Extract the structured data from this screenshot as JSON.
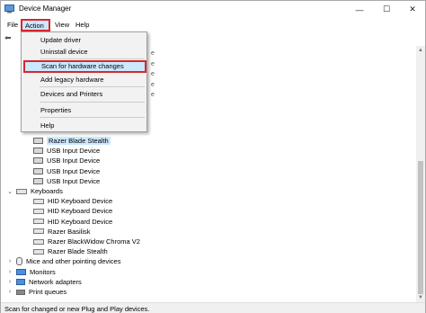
{
  "window": {
    "title": "Device Manager",
    "controls": {
      "minimize": "—",
      "maximize": "☐",
      "close": "✕"
    }
  },
  "menubar": {
    "file": "File",
    "action": "Action",
    "view": "View",
    "help": "Help"
  },
  "action_menu": {
    "items": [
      "Update driver",
      "Uninstall device",
      "Scan for hardware changes",
      "Add legacy hardware",
      "Devices and Printers",
      "Properties",
      "Help"
    ],
    "highlighted": "Scan for hardware changes"
  },
  "tree": {
    "peeking": [
      "e",
      "e",
      "e",
      "e",
      "e"
    ],
    "rows": [
      {
        "label": "Razer Blade Stealth",
        "indent": 2,
        "icon": "hid-icon",
        "selected": true
      },
      {
        "label": "USB Input Device",
        "indent": 2,
        "icon": "hid-icon"
      },
      {
        "label": "USB Input Device",
        "indent": 2,
        "icon": "hid-icon"
      },
      {
        "label": "USB Input Device",
        "indent": 2,
        "icon": "hid-icon"
      },
      {
        "label": "USB Input Device",
        "indent": 2,
        "icon": "hid-icon"
      },
      {
        "label": "Keyboards",
        "indent": 1,
        "icon": "keyboard-category-icon",
        "expander": "expanded"
      },
      {
        "label": "HID Keyboard Device",
        "indent": 2,
        "icon": "keyboard-icon"
      },
      {
        "label": "HID Keyboard Device",
        "indent": 2,
        "icon": "keyboard-icon"
      },
      {
        "label": "HID Keyboard Device",
        "indent": 2,
        "icon": "keyboard-icon"
      },
      {
        "label": "Razer Basilisk",
        "indent": 2,
        "icon": "keyboard-icon"
      },
      {
        "label": "Razer BlackWidow Chroma V2",
        "indent": 2,
        "icon": "keyboard-icon"
      },
      {
        "label": "Razer Blade Stealth",
        "indent": 2,
        "icon": "keyboard-icon"
      },
      {
        "label": "Mice and other pointing devices",
        "indent": 1,
        "icon": "mouse-icon",
        "expander": "collapsed"
      },
      {
        "label": "Monitors",
        "indent": 1,
        "icon": "monitor-icon",
        "expander": "collapsed"
      },
      {
        "label": "Network adapters",
        "indent": 1,
        "icon": "network-adapter-icon",
        "expander": "collapsed"
      },
      {
        "label": "Print queues",
        "indent": 1,
        "icon": "printer-icon",
        "expander": "collapsed"
      }
    ]
  },
  "statusbar": {
    "text": "Scan for changed or new Plug and Play devices."
  },
  "toolbar": {
    "back_glyph": "⬅"
  },
  "glyphs": {
    "expanded": "⌄",
    "collapsed": "›",
    "scroll_up": "▲",
    "scroll_down": "▼"
  }
}
